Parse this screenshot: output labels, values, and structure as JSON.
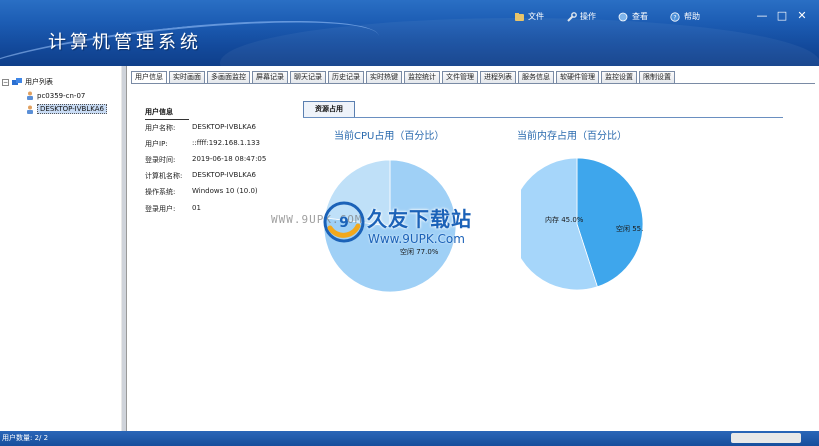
{
  "header": {
    "title": "计算机管理系统",
    "menu": [
      {
        "label": "文件",
        "icon": "file-icon"
      },
      {
        "label": "操作",
        "icon": "wrench-icon"
      },
      {
        "label": "查看",
        "icon": "view-icon"
      },
      {
        "label": "帮助",
        "icon": "help-icon"
      }
    ],
    "window_controls": {
      "minimize": "—",
      "restore": "□",
      "close": "✕"
    }
  },
  "tree": {
    "root": "用户列表",
    "root_expander": "−",
    "children": [
      "pc0359-cn-07",
      "DESKTOP-IVBLKA6"
    ]
  },
  "tabs": [
    "用户信息",
    "实时画面",
    "多画面监控",
    "屏幕记录",
    "聊天记录",
    "历史记录",
    "实时热键",
    "监控统计",
    "文件管理",
    "进程列表",
    "服务信息",
    "软硬件管理",
    "监控设置",
    "限制设置"
  ],
  "user_info": {
    "heading": "用户信息",
    "rows": [
      {
        "label": "用户名称:",
        "value": "DESKTOP-IVBLKA6"
      },
      {
        "label": "用户IP:",
        "value": "::ffff:192.168.1.133"
      },
      {
        "label": "登录时间:",
        "value": "2019-06-18 08:47:05"
      },
      {
        "label": "计算机名称:",
        "value": "DESKTOP-IVBLKA6"
      },
      {
        "label": "操作系统:",
        "value": "Windows 10 (10.0)"
      },
      {
        "label": "登录用户:",
        "value": "01"
      }
    ]
  },
  "resource": {
    "tab_label": "资源占用",
    "cpu_title": "当前CPU占用（百分比）",
    "mem_title": "当前内存占用（百分比）"
  },
  "chart_data": [
    {
      "type": "pie",
      "title": "当前CPU占用（百分比）",
      "categories": [
        "空闲",
        "占用"
      ],
      "values": [
        77.0,
        23.0
      ],
      "labels": [
        "空闲 77.0%",
        ""
      ],
      "colors": [
        "#9fd0f6",
        "#bfe0f8"
      ]
    },
    {
      "type": "pie",
      "title": "当前内存占用（百分比）",
      "categories": [
        "内存",
        "空闲"
      ],
      "values": [
        45.0,
        55.0
      ],
      "labels": [
        "内存 45.0%",
        "空闲 55.0%"
      ],
      "colors": [
        "#3ea6ec",
        "#a6d6fa"
      ]
    }
  ],
  "watermark": {
    "left": "WWW.9UPK.COM",
    "cn": "久友下载站",
    "en": "Www.9UPK.Com"
  },
  "status": {
    "text": "用户数量: 2/ 2"
  },
  "colors": {
    "header": "#1c5cb3",
    "accent": "#2a6aae",
    "status_bar": "#1f58a8"
  }
}
